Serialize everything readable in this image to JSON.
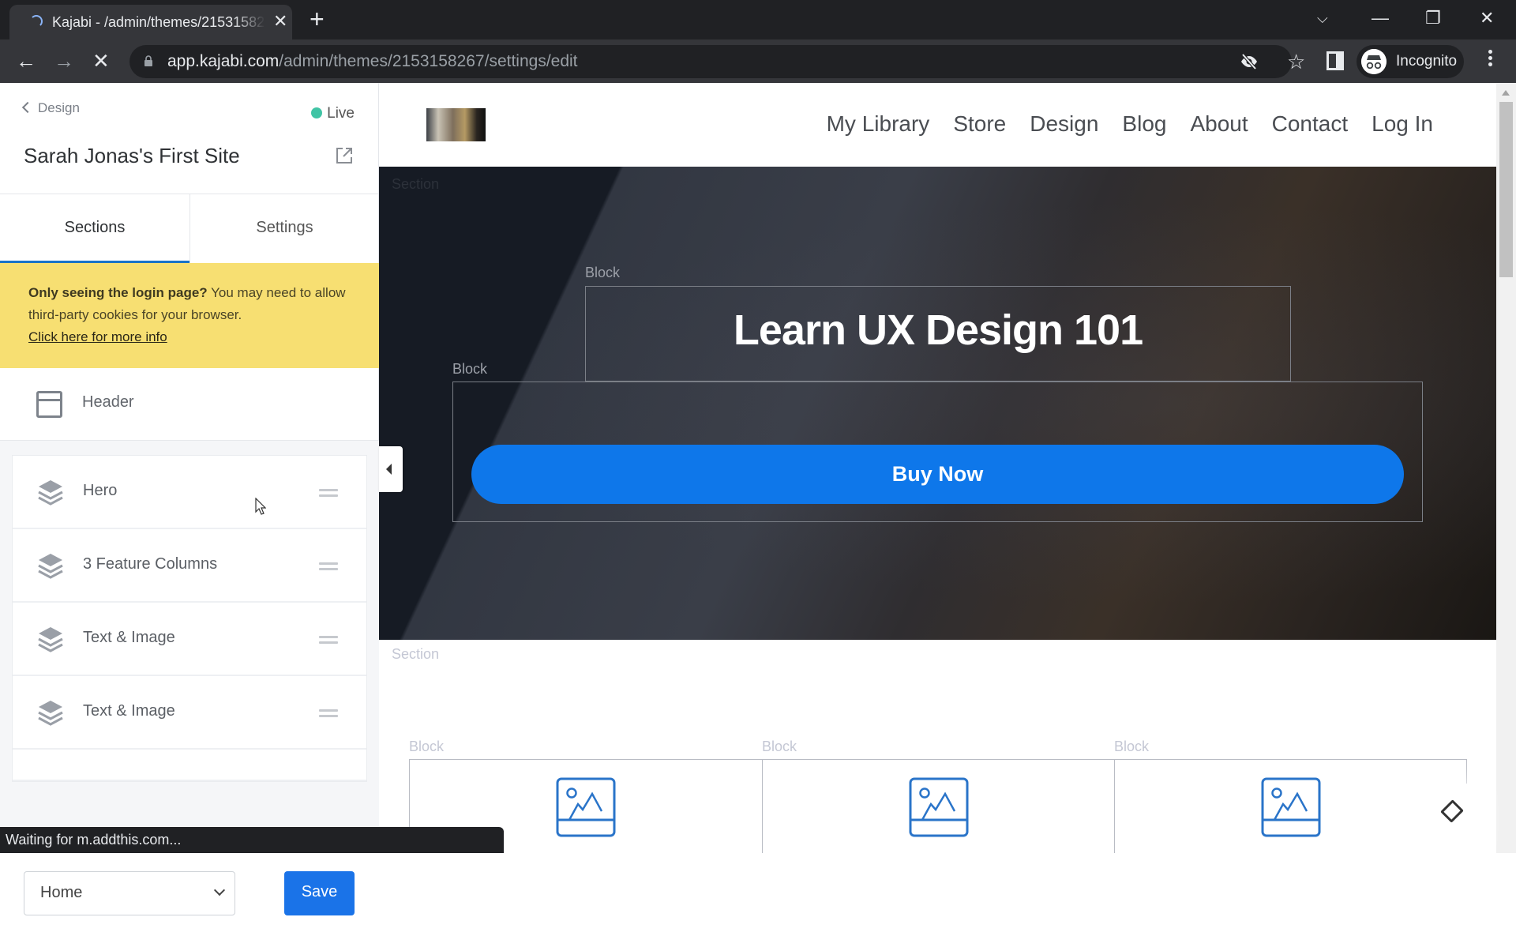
{
  "browser": {
    "tab_title": "Kajabi - /admin/themes/2153158267/settings/edit",
    "tab_close": "✕",
    "new_tab": "+",
    "url_domain": "app.kajabi.com",
    "url_path": "/admin/themes/2153158267/settings/edit",
    "profile_label": "Incognito",
    "window_controls": {
      "dropdown": "⌵",
      "minimize": "—",
      "restore": "❐",
      "close": "✕"
    },
    "nav": {
      "back": "←",
      "forward": "→",
      "stop": "✕"
    },
    "star": "☆",
    "status_text": "Waiting for m.addthis.com..."
  },
  "panel": {
    "back_label": "Design",
    "live_label": "Live",
    "live_color": "#40c4a5",
    "site_title": "Sarah Jonas's First Site",
    "tabs": [
      {
        "label": "Sections",
        "active": true
      },
      {
        "label": "Settings",
        "active": false
      }
    ],
    "notice": {
      "bold": "Only seeing the login page?",
      "text": " You may need to allow third-party cookies for your browser.",
      "link": "Click here for more info"
    },
    "header_item": "Header",
    "sections": [
      {
        "label": "Hero"
      },
      {
        "label": "3 Feature Columns"
      },
      {
        "label": "Text & Image"
      },
      {
        "label": "Text & Image"
      }
    ],
    "page_select": {
      "value": "Home"
    },
    "save_label": "Save",
    "accent": "#1a73e8"
  },
  "preview": {
    "nav": [
      "My Library",
      "Store",
      "Design",
      "Blog",
      "About",
      "Contact",
      "Log In"
    ],
    "hero": {
      "section_label": "Section",
      "title_block_label": "Block",
      "title": "Learn UX Design 101",
      "button_block_label": "Block",
      "button_label": "Buy Now",
      "button_color": "#0e77ea"
    },
    "section2_label": "Section",
    "columns": [
      {
        "block_label": "Block"
      },
      {
        "block_label": "Block"
      },
      {
        "block_label": "Block"
      }
    ]
  }
}
